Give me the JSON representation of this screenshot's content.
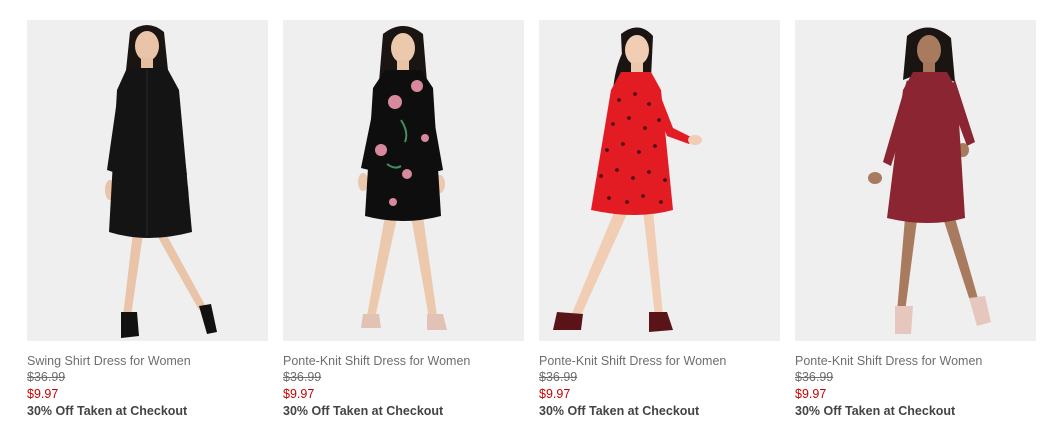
{
  "products": [
    {
      "name": "Swing Shirt Dress for Women",
      "was_price": "$36.99",
      "sale_price": "$9.97",
      "promo": "30% Off Taken at Checkout",
      "dress_color": "#141414",
      "pattern": "plain",
      "shoe_color": "#111111"
    },
    {
      "name": "Ponte-Knit Shift Dress for Women",
      "was_price": "$36.99",
      "sale_price": "$9.97",
      "promo": "30% Off Taken at Checkout",
      "dress_color": "#0e0e0e",
      "pattern": "floral",
      "shoe_color": "#e3c2b6"
    },
    {
      "name": "Ponte-Knit Shift Dress for Women",
      "was_price": "$36.99",
      "sale_price": "$9.97",
      "promo": "30% Off Taken at Checkout",
      "dress_color": "#e31b23",
      "pattern": "dots",
      "shoe_color": "#5a1418"
    },
    {
      "name": "Ponte-Knit Shift Dress for Women",
      "was_price": "$36.99",
      "sale_price": "$9.97",
      "promo": "30% Off Taken at Checkout",
      "dress_color": "#8a2531",
      "pattern": "plain",
      "shoe_color": "#e6c7bd"
    }
  ]
}
